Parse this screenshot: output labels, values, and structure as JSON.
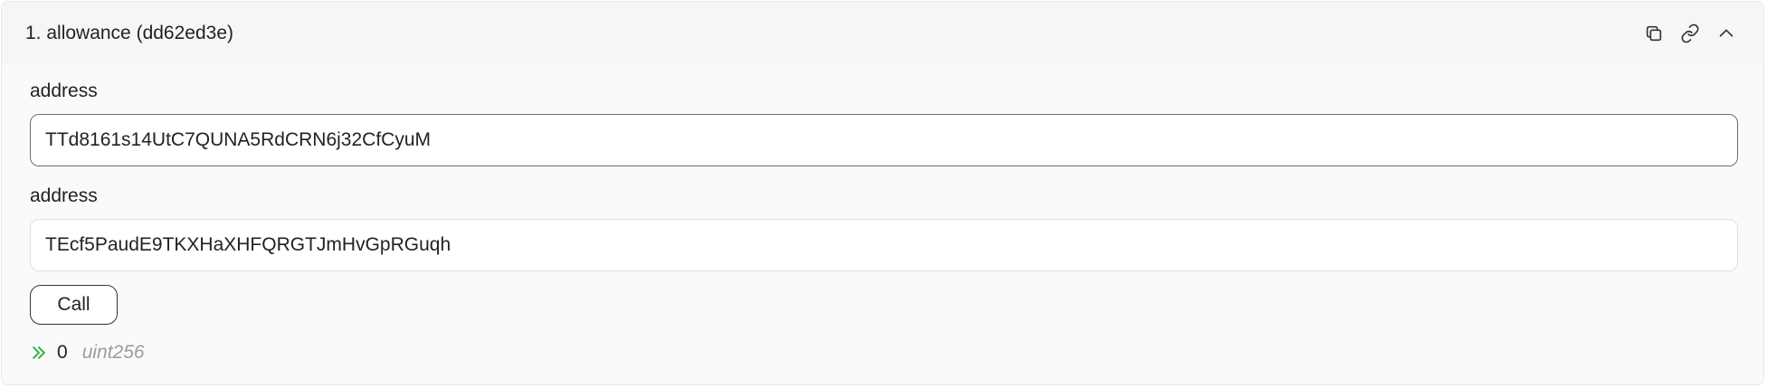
{
  "header": {
    "title": "1. allowance (dd62ed3e)",
    "actions": [
      {
        "name": "copy",
        "icon": "copy-icon"
      },
      {
        "name": "link",
        "icon": "link-icon"
      },
      {
        "name": "collapse",
        "icon": "chevron-up-icon"
      }
    ]
  },
  "inputs": [
    {
      "label": "address",
      "value": "TTd8161s14UtC7QUNA5RdCRN6j32CfCyuM",
      "state": "focused"
    },
    {
      "label": "address",
      "value": "TEcf5PaudE9TKXHaXHFQRGTJmHvGpRGuqh",
      "state": "idle"
    }
  ],
  "call_button": {
    "label": "Call"
  },
  "result": {
    "icon": "double-chevron-right-icon",
    "value": "0",
    "type": "uint256",
    "icon_color": "#2eb84a"
  }
}
